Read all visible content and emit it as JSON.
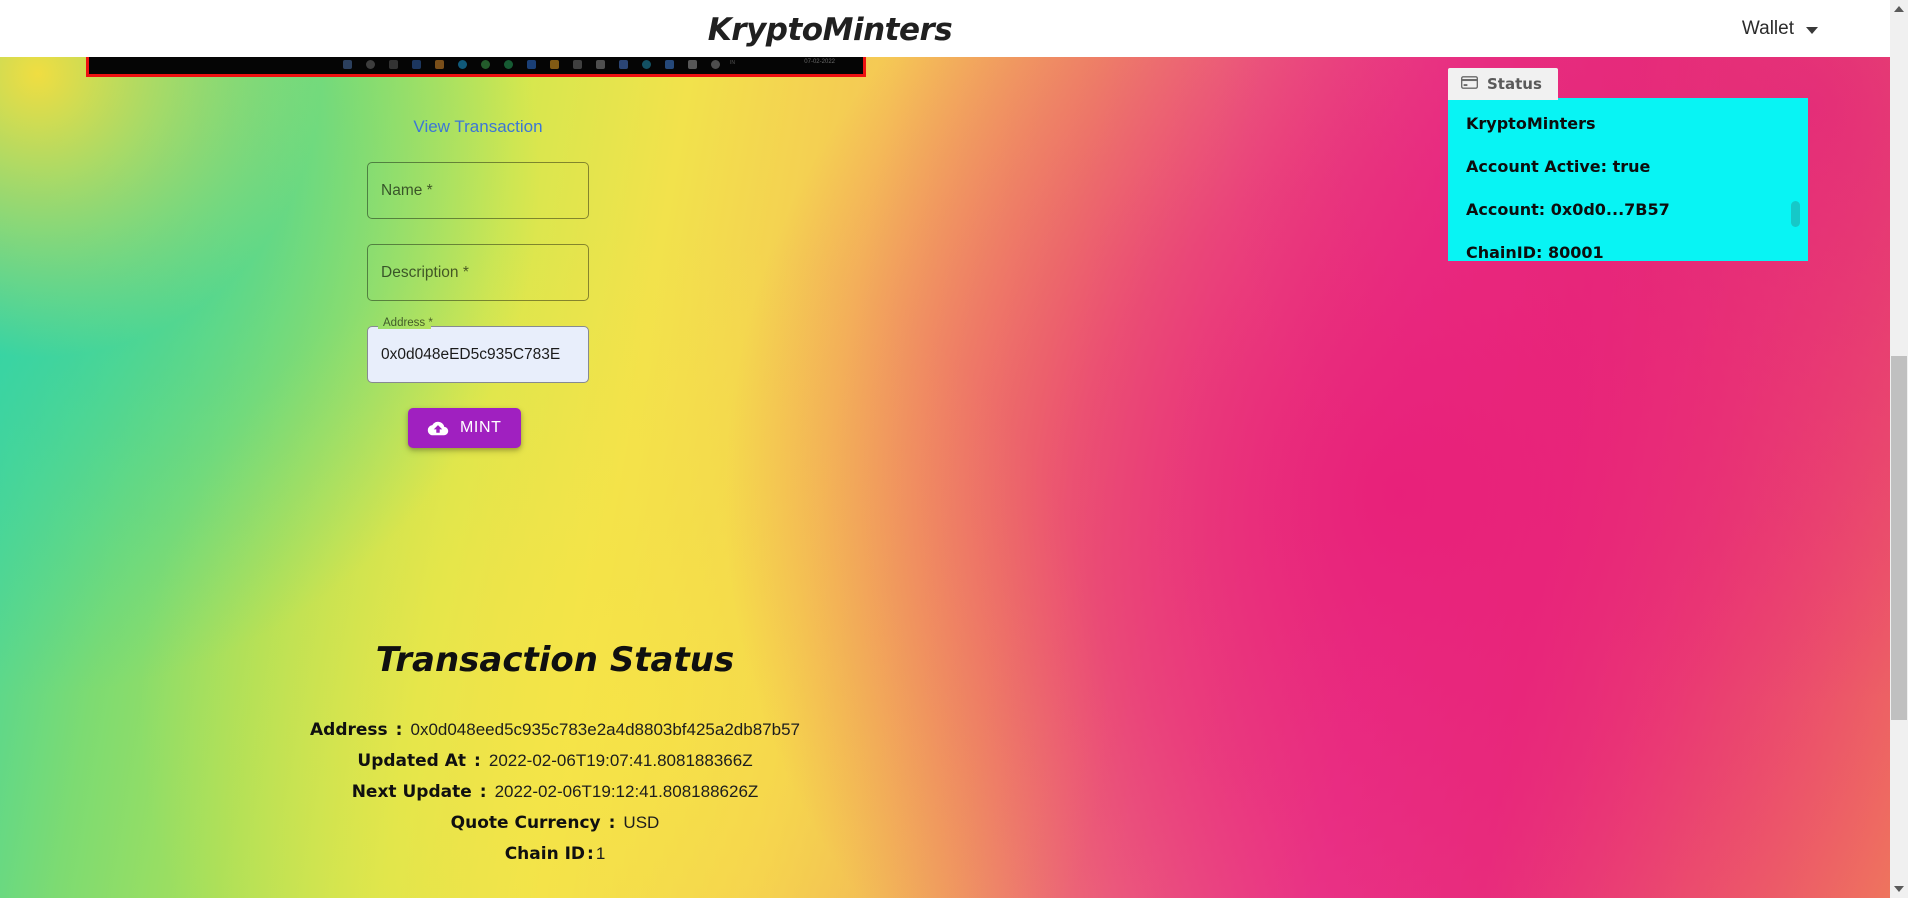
{
  "appbar": {
    "title": "KryptoMinters",
    "wallet_label": "Wallet",
    "caret_icon": "chevron-down-icon"
  },
  "embedded_screenshot": {
    "alt": "cropped desktop taskbar screenshot",
    "clock": "07-02-2022",
    "tray_locale": "IN",
    "border_color": "#ee1111",
    "background_color": "#050505"
  },
  "form": {
    "view_transaction_link": "View Transaction",
    "fields": [
      {
        "name": "name",
        "placeholder": "Name *",
        "value": "",
        "filled": false
      },
      {
        "name": "description",
        "placeholder": "Description *",
        "value": "",
        "filled": false
      },
      {
        "name": "address",
        "placeholder": "Address *",
        "label": "Address *",
        "value": "0x0d048eED5c935C783E",
        "filled": true
      }
    ],
    "mint_button": {
      "label": "MINT",
      "icon": "cloud-upload-icon",
      "color": "#a020c0"
    }
  },
  "transaction_status": {
    "heading": "Transaction Status",
    "separator": ":",
    "rows": [
      {
        "label": "Address",
        "value": "0x0d048eed5c935c783e2a4d8803bf425a2db87b57"
      },
      {
        "label": "Updated At",
        "value": "2022-02-06T19:07:41.808188366Z"
      },
      {
        "label": "Next Update",
        "value": "2022-02-06T19:12:41.808188626Z"
      },
      {
        "label": "Quote Currency",
        "value": "USD"
      },
      {
        "label": "Chain ID",
        "value": "1"
      }
    ]
  },
  "status_panel": {
    "tab_label": "Status",
    "tab_icon": "credit-card-icon",
    "background_color": "#08f4f4",
    "lines": [
      "KryptoMinters",
      "Account Active: true",
      "Account: 0x0d0...7B57",
      "ChainID: 80001"
    ]
  },
  "scrollbar": {
    "up_icon": "scroll-up-arrow-icon",
    "down_icon": "scroll-down-arrow-icon",
    "thumb": "scrollbar-thumb"
  }
}
